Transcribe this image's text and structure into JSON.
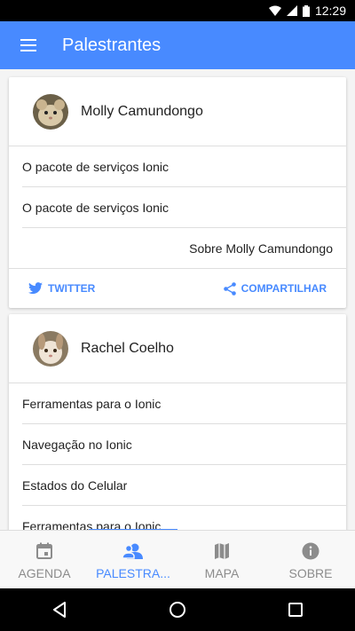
{
  "status_bar": {
    "time": "12:29"
  },
  "toolbar": {
    "title": "Palestrantes",
    "menu_icon": "menu-icon"
  },
  "speakers": [
    {
      "name": "Molly Camundongo",
      "sessions": [
        "O pacote de serviços Ionic",
        "O pacote de serviços Ionic"
      ],
      "about": "Sobre Molly Camundongo",
      "twitter_label": "TWITTER",
      "share_label": "COMPARTILHAR"
    },
    {
      "name": "Rachel Coelho",
      "sessions": [
        "Ferramentas para o Ionic",
        "Navegação no Ionic",
        "Estados do Celular",
        "Ferramentas para o Ionic"
      ]
    }
  ],
  "tabs": [
    {
      "label": "AGENDA",
      "icon": "calendar-icon",
      "active": false
    },
    {
      "label": "PALESTRA...",
      "icon": "contacts-icon",
      "active": true
    },
    {
      "label": "MAPA",
      "icon": "map-icon",
      "active": false
    },
    {
      "label": "SOBRE",
      "icon": "info-icon",
      "active": false
    }
  ],
  "colors": {
    "primary": "#488aff",
    "tab_inactive": "#8c8c8c"
  }
}
